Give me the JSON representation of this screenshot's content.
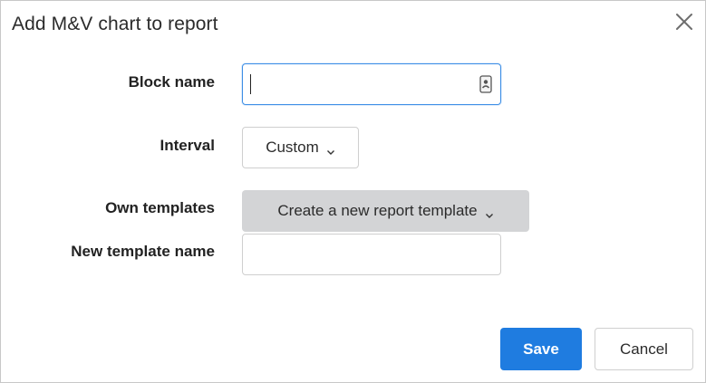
{
  "dialog": {
    "title": "Add M&V chart to report",
    "close_icon": "close-icon"
  },
  "form": {
    "block_name": {
      "label": "Block name",
      "value": "",
      "icon": "contact-card-icon"
    },
    "interval": {
      "label": "Interval",
      "selected": "Custom",
      "icon": "chevron-down-icon"
    },
    "own_templates": {
      "label": "Own templates",
      "selected": "Create a new report template",
      "icon": "chevron-down-icon"
    },
    "new_template_name": {
      "label": "New template name",
      "value": ""
    }
  },
  "footer": {
    "save_label": "Save",
    "cancel_label": "Cancel"
  },
  "colors": {
    "primary": "#1f7ce0",
    "focus_border": "#3d8ee6",
    "grey_button": "#d3d4d6"
  }
}
